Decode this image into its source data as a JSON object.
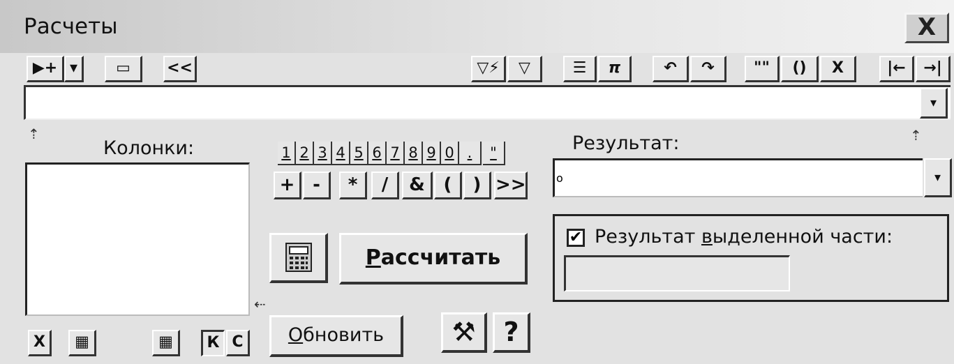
{
  "window": {
    "title": "Расчеты",
    "close_glyph": "X"
  },
  "toolbar": {
    "pointer_add": "▶+",
    "pointer_dropdown": "▾",
    "field": "▭",
    "back": "<<",
    "filter_lightning": "▽⚡",
    "filter": "▽",
    "list": "☰",
    "pi": "π",
    "undo": "↶",
    "redo": "↷",
    "quote": "\"\"",
    "parens": "()",
    "clear": "X",
    "home": "|←",
    "end": "→|"
  },
  "expression_dropdown": "▾",
  "columns": {
    "label": "Колонки:"
  },
  "digits": [
    "1",
    "2",
    "3",
    "4",
    "5",
    "6",
    "7",
    "8",
    "9",
    "0",
    ".",
    "\""
  ],
  "operators": [
    "+",
    "-",
    "*",
    "/",
    "&",
    "(",
    ")",
    ">>"
  ],
  "calc": {
    "calculate_label": "ассчитать",
    "calculate_mnemonic": "Р",
    "calculator_icon": "calculator-icon"
  },
  "update": {
    "mnemonic": "О",
    "label": "бновить"
  },
  "result": {
    "label": "Результат:",
    "indicator": "o",
    "dropdown": "▾"
  },
  "selection": {
    "checked_mark": "✔",
    "label_before": "Результат ",
    "label_mnemonic": "в",
    "label_after": "ыделенной части:"
  },
  "list_buttons": {
    "delete": "X",
    "grid": "▦",
    "grid2": "▦",
    "k": "К",
    "c": "С"
  },
  "bottom_icons": {
    "tools": "⚒",
    "help": "?"
  }
}
